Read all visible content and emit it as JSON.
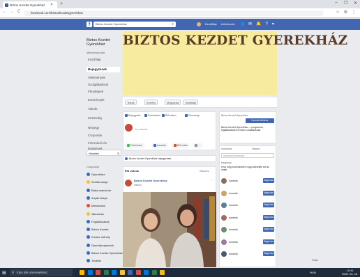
{
  "browser": {
    "tab_title": "Biztos Kezdet Gyerekház",
    "url": "facebook.com/biztoskezdetgyerekhaz",
    "nav": [
      "←",
      "→",
      "C"
    ],
    "window_controls": [
      "–",
      "❐",
      "✕"
    ],
    "right_icons": [
      "☆",
      "⚙",
      "⋮"
    ]
  },
  "fb_header": {
    "logo": "f",
    "search_value": "Biztos Kezdet Gyerekház",
    "nav_items": [
      "Kezdőlap",
      "Létrehozás"
    ]
  },
  "sidebar": {
    "page_name": "Biztos Kezdet Gyerekház",
    "page_handle": "@biztoskezdet",
    "items": [
      {
        "label": "Kezdőlap"
      },
      {
        "label": "Bejegyzések"
      },
      {
        "label": "Vélemények"
      },
      {
        "label": "Szolgáltatások"
      },
      {
        "label": "Fényképek"
      },
      {
        "label": "Események"
      },
      {
        "label": "Videók"
      },
      {
        "label": "Közösség"
      },
      {
        "label": "Névjegy"
      },
      {
        "label": "Csoportok"
      },
      {
        "label": "Információ és hirdetések"
      }
    ],
    "promote": "Hirdetés",
    "groups_header": "Csoportok",
    "groups": [
      {
        "label": "Gyerekház"
      },
      {
        "label": "Szülők klubja"
      },
      {
        "label": "Baba-mama kör"
      },
      {
        "label": "Anyák klubja"
      },
      {
        "label": "Mesekuckó"
      },
      {
        "label": "Játszóház"
      },
      {
        "label": "Foglalkozások"
      },
      {
        "label": "Biztos Kezdet"
      },
      {
        "label": "Kreatív műhely"
      },
      {
        "label": "Gyerekprogramok"
      },
      {
        "label": "Biztos Kezdet Gyerekház"
      },
      {
        "label": "További"
      }
    ]
  },
  "cover": {
    "title": "BIZTOS KEZDET GYEREKHÁZ",
    "actions": [
      "Tetszik",
      "Követés",
      "Megosztás",
      "Továbbiak"
    ]
  },
  "composer": {
    "tabs": [
      "Bejegyzés",
      "Fotó/videó",
      "Élő videó",
      "Esemény"
    ],
    "placeholder": "Írj valamit...",
    "buttons": [
      "Fotó/videó",
      "Ismerős",
      "Élő videó",
      "…"
    ]
  },
  "infobar": {
    "text": "Biztos Kezdet Gyerekház bejegyzései"
  },
  "post": {
    "header": "Élő videók",
    "more": "Összes",
    "author": "Biztos Kezdet Gyerekház",
    "time": "élőben",
    "dots": "···"
  },
  "right_col": {
    "card1_head": "Biztos Kezdet Gyerekház",
    "card1_button": "Üzenet küldése",
    "card1_text": "Biztos Kezdet Gyerekház — programok, foglalkozások és hírek a családoknak.",
    "card2_head": "Ismerősök",
    "card2_link": "Összes",
    "card2_search": "Ismerősök keresése",
    "card2_sub": "Meghívás",
    "card2_text": "Hívd meg ismerőseidet, hogy kedveljék ezt az oldalt.",
    "invite_label": "Meghívás",
    "people": [
      {
        "name": "Ismerős",
        "color": "#8a6d5a"
      },
      {
        "name": "Ismerős",
        "color": "#c9a46b"
      },
      {
        "name": "Ismerős",
        "color": "#5e7e9c"
      },
      {
        "name": "Ismerős",
        "color": "#a56a5b"
      },
      {
        "name": "Ismerős",
        "color": "#6b8e6b"
      },
      {
        "name": "Ismerős",
        "color": "#9b7b9e"
      },
      {
        "name": "Ismerős",
        "color": "#4a5a6a"
      }
    ]
  },
  "chat": {
    "label": "Chat"
  },
  "taskbar": {
    "search_placeholder": "Írjon ide a kereséshez",
    "systray": "HUN",
    "time": "10:41",
    "date": "2020. 04. 15."
  }
}
